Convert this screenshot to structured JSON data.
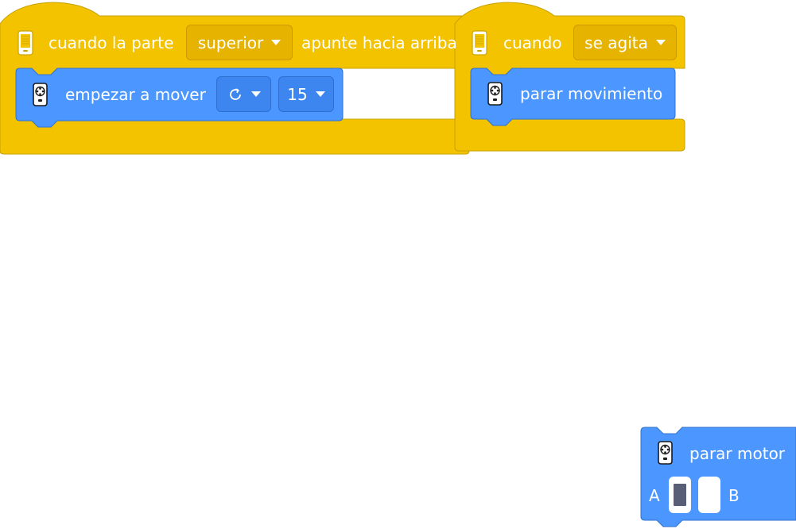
{
  "event_block_tilt": {
    "prefix": "cuando la parte",
    "dropdown_value": "superior",
    "suffix": "apunte hacia arriba",
    "icon": "tablet-icon"
  },
  "motion_block_start": {
    "label": "empezar a mover",
    "direction_icon": "rotate-clockwise-icon",
    "speed_value": "15",
    "icon": "remote-control-icon"
  },
  "event_block_shake": {
    "prefix": "cuando",
    "dropdown_value": "se agita",
    "icon": "tablet-icon"
  },
  "motion_block_stop": {
    "label": "parar movimiento",
    "icon": "remote-control-icon"
  },
  "motor_block_stop": {
    "label": "parar motor",
    "port_a": "A",
    "port_b": "B",
    "icon": "remote-control-icon"
  },
  "colors": {
    "event_yellow": "#f3c300",
    "event_border": "#c7a000",
    "motion_blue": "#4c97ff",
    "motion_border": "#3373cc"
  }
}
